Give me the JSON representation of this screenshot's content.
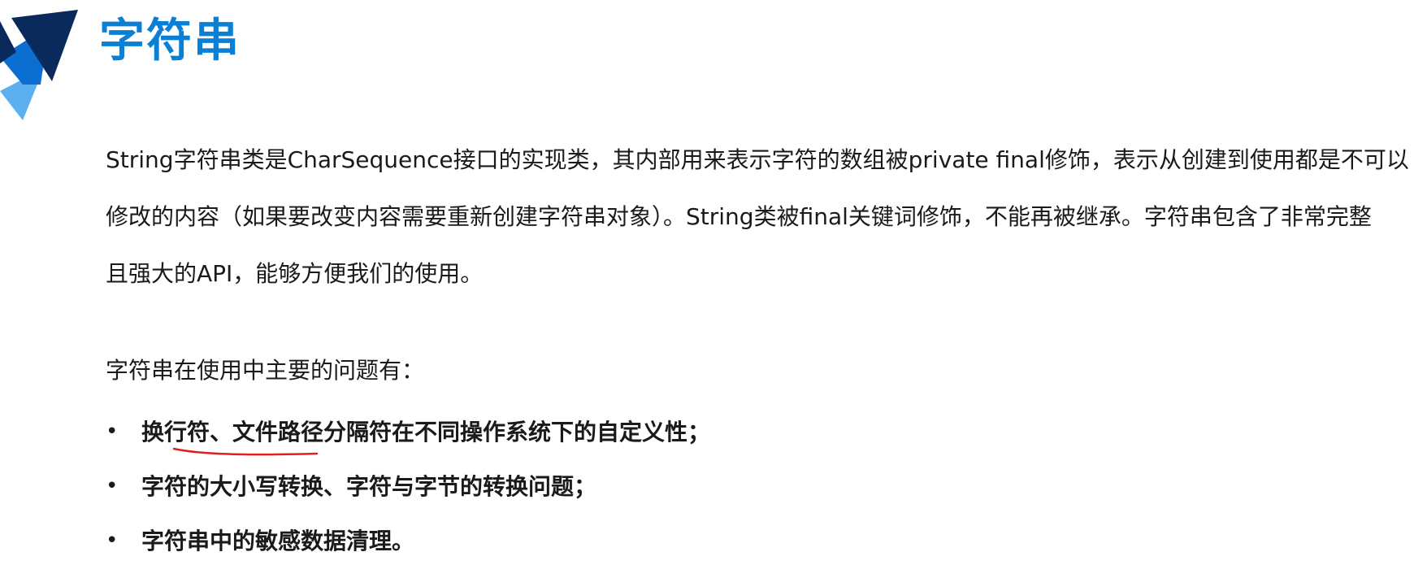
{
  "colors": {
    "accent": "#0a7fd6",
    "logo_dark": "#0a2a5c",
    "logo_mid": "#0a6fd0",
    "logo_light": "#5cb0f0",
    "text": "#1a1a1a",
    "annotation": "#e02020"
  },
  "slide": {
    "title": "字符串",
    "logo_icon": "chevron-logo-icon",
    "paragraph_lines": [
      "String字符串类是CharSequence接口的实现类，其内部用来表示字符的数组被private final修饰，表示从创建到使用都是不可以",
      "修改的内容（如果要改变内容需要重新创建字符串对象）。String类被final关键词修饰，不能再被继承。字符串包含了非常完整",
      "且强大的API，能够方便我们的使用。"
    ],
    "intro": "字符串在使用中主要的问题有：",
    "bullet_marker": "•",
    "bullets": [
      "换行符、文件路径分隔符在不同操作系统下的自定义性；",
      "字符的大小写转换、字符与字节的转换问题；",
      "字符串中的敏感数据清理。"
    ]
  }
}
